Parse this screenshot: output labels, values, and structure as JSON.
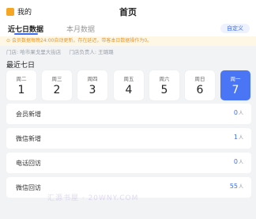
{
  "header": {
    "me_label": "我的",
    "title": "首页"
  },
  "tabs": [
    {
      "label": "近七日数据"
    },
    {
      "label": "本月数据"
    }
  ],
  "custom_button": "自定义",
  "notice": "会员数据每晚24:00自动更新，存在延迟，带客本日数据操作为0。",
  "store": {
    "name": "门店: 哈市果戈里大街店",
    "manager": "门店负责人: 王璐璐"
  },
  "section_title": "最近七日",
  "days": [
    {
      "name": "周二",
      "num": "1"
    },
    {
      "name": "周三",
      "num": "2"
    },
    {
      "name": "周四",
      "num": "3"
    },
    {
      "name": "周五",
      "num": "4"
    },
    {
      "name": "周六",
      "num": "5"
    },
    {
      "name": "周日",
      "num": "6"
    },
    {
      "name": "周一",
      "num": "7"
    }
  ],
  "stats": [
    {
      "label": "会员新增",
      "value": "0",
      "unit": "人"
    },
    {
      "label": "微信新增",
      "value": "1",
      "unit": "人"
    },
    {
      "label": "电话回访",
      "value": "0",
      "unit": "人"
    },
    {
      "label": "微信回访",
      "value": "55",
      "unit": "人"
    }
  ],
  "watermark": "汇源书屋 · 20WNY.COM"
}
